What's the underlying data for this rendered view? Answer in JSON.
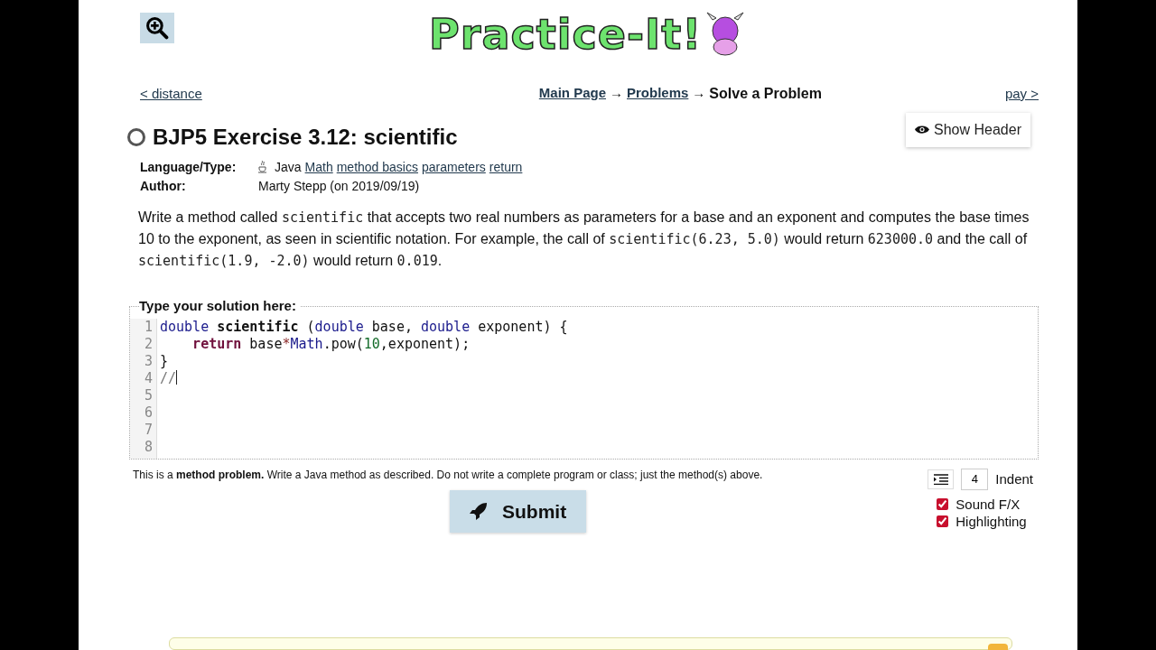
{
  "logo": {
    "text": "Practice-It!"
  },
  "nav": {
    "prev": "< distance",
    "next": "pay >",
    "breadcrumb": [
      {
        "text": "Main Page",
        "link": true
      },
      {
        "text": "→",
        "link": false
      },
      {
        "text": "Problems",
        "link": true
      },
      {
        "text": "→",
        "link": false
      },
      {
        "text": "Solve a Problem",
        "link": false
      }
    ]
  },
  "show_header": "Show Header",
  "problem": {
    "solved": false,
    "title": "BJP5 Exercise 3.12: scientific",
    "meta": [
      {
        "label": "Language/Type:",
        "lang": "Java",
        "tags": [
          "Math",
          "method basics",
          "parameters",
          "return"
        ]
      },
      {
        "label": "Author:",
        "value": "Marty Stepp (on 2019/09/19)"
      }
    ],
    "description": [
      {
        "kind": "text",
        "text": "Write a method called "
      },
      {
        "kind": "code",
        "text": "scientific"
      },
      {
        "kind": "text",
        "text": " that accepts two real numbers as parameters for a base and an exponent and computes the base times 10 to the exponent, as seen in scientific notation. For example, the call of "
      },
      {
        "kind": "code",
        "text": "scientific(6.23, 5.0)"
      },
      {
        "kind": "text",
        "text": " would return "
      },
      {
        "kind": "code",
        "text": "623000.0"
      },
      {
        "kind": "text",
        "text": " and the call of "
      },
      {
        "kind": "code",
        "text": "scientific(1.9, -2.0)"
      },
      {
        "kind": "text",
        "text": " would return "
      },
      {
        "kind": "code",
        "text": "0.019"
      },
      {
        "kind": "text",
        "text": "."
      }
    ]
  },
  "editor": {
    "label": "Type your solution here:",
    "lines": [
      {
        "number": "1",
        "tokens": [
          {
            "kind": "keyword",
            "text": "double"
          },
          {
            "kind": "name",
            "text": " scientific"
          },
          {
            "kind": "plain",
            "text": " ("
          },
          {
            "kind": "keyword",
            "text": "double"
          },
          {
            "kind": "plain",
            "text": " base, "
          },
          {
            "kind": "keyword",
            "text": "double"
          },
          {
            "kind": "plain",
            "text": " exponent) {"
          }
        ]
      },
      {
        "number": "2",
        "tokens": [
          {
            "kind": "control",
            "text": "    return"
          },
          {
            "kind": "plain",
            "text": " base"
          },
          {
            "kind": "operator",
            "text": "*"
          },
          {
            "kind": "keyword",
            "text": "Math"
          },
          {
            "kind": "plain",
            "text": ".pow("
          },
          {
            "kind": "number",
            "text": "10"
          },
          {
            "kind": "plain",
            "text": ",exponent);"
          }
        ]
      },
      {
        "number": "3",
        "tokens": [
          {
            "kind": "plain",
            "text": "}"
          }
        ]
      },
      {
        "number": "4",
        "tokens": [
          {
            "kind": "comment",
            "text": "//"
          }
        ],
        "cursor": true
      },
      {
        "number": "5"
      },
      {
        "number": "6"
      },
      {
        "number": "7"
      },
      {
        "number": "8"
      }
    ]
  },
  "note": "This is a **method problem.** Write a Java method as described. Do not write a complete program or class; just the method(s) above.",
  "submit": "Submit",
  "indent": {
    "value": "4",
    "label": "Indent"
  },
  "options": [
    {
      "label": "Sound F/X",
      "checked": true
    },
    {
      "label": "Highlighting",
      "checked": true
    }
  ]
}
